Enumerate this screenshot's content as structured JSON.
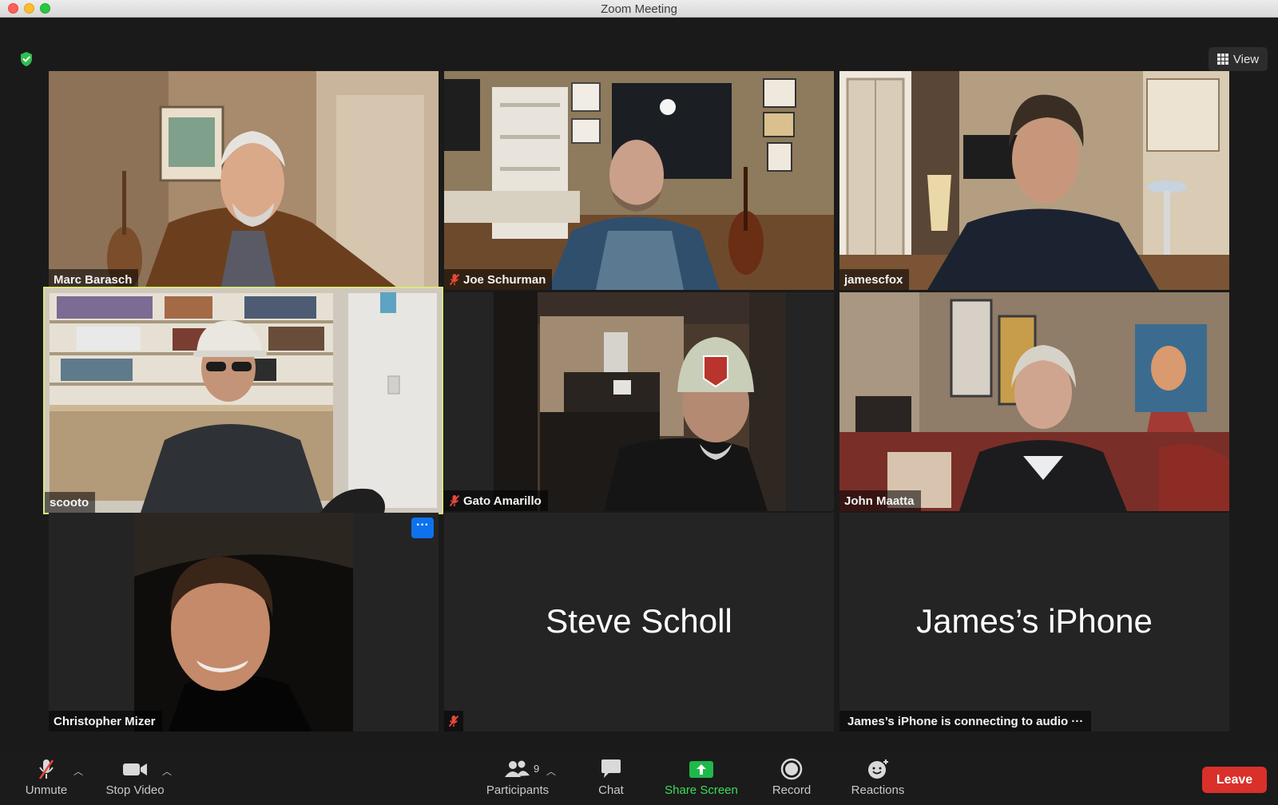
{
  "window": {
    "title": "Zoom Meeting"
  },
  "header": {
    "view_label": "View"
  },
  "tiles": [
    {
      "name": "Marc Barasch",
      "muted": false
    },
    {
      "name": "Joe Schurman",
      "muted": true
    },
    {
      "name": "jamescfox",
      "muted": false
    },
    {
      "name": "scooto",
      "muted": false,
      "active_speaker": true
    },
    {
      "name": "Gato Amarillo",
      "muted": true
    },
    {
      "name": "John Maatta",
      "muted": false
    },
    {
      "name": "Christopher Mizer",
      "muted": false
    },
    {
      "name": "Steve Scholl",
      "muted": true,
      "video_off": true
    },
    {
      "name": "James’s iPhone",
      "status": "James’s iPhone is connecting to audio ···",
      "video_off": true
    }
  ],
  "more_button": "···",
  "toolbar": {
    "unmute": "Unmute",
    "stop_video": "Stop Video",
    "participants": "Participants",
    "participants_count": "9",
    "chat": "Chat",
    "share_screen": "Share Screen",
    "record": "Record",
    "reactions": "Reactions",
    "leave": "Leave"
  },
  "colors": {
    "active_speaker_border": "#d8e87a",
    "share_green": "#3ddc5a",
    "leave_red": "#d9302a",
    "more_blue": "#0e72ed"
  }
}
